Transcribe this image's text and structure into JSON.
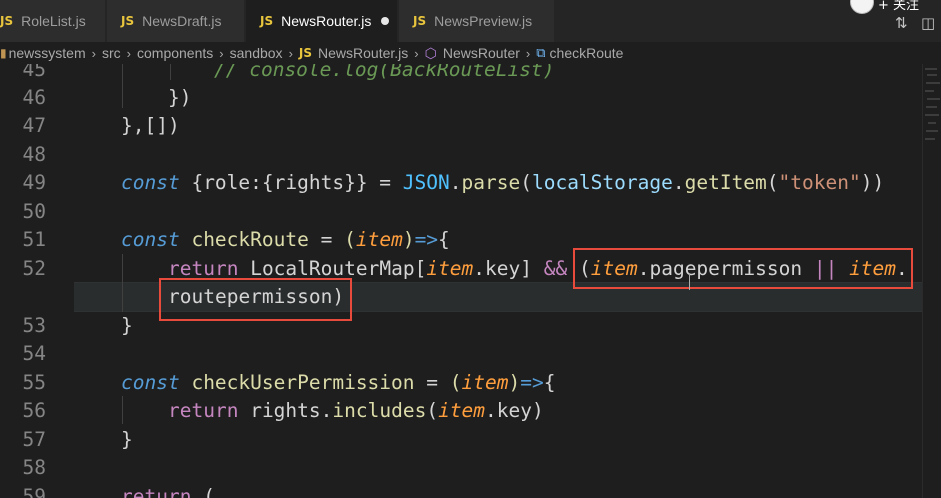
{
  "tabs": [
    {
      "badge": "JS",
      "label": "RoleList.js",
      "active": false,
      "modified": false
    },
    {
      "badge": "JS",
      "label": "NewsDraft.js",
      "active": false,
      "modified": false
    },
    {
      "badge": "JS",
      "label": "NewsRouter.js",
      "active": true,
      "modified": true
    },
    {
      "badge": "JS",
      "label": "NewsPreview.js",
      "active": false,
      "modified": false
    }
  ],
  "top_right": {
    "follow_label": "+ 关注"
  },
  "breadcrumb": {
    "items": [
      "newssystem",
      "src",
      "components",
      "sandbox",
      "NewsRouter.js",
      "NewsRouter",
      "checkRoute"
    ],
    "file_badge": "JS"
  },
  "editor": {
    "line_numbers": [
      "45",
      "46",
      "47",
      "48",
      "49",
      "50",
      "51",
      "52",
      "",
      "53",
      "54",
      "55",
      "56",
      "57",
      "58",
      "59"
    ],
    "comment_45": "// console.log(BackRouteList)",
    "l46_close": "})",
    "l47_close": "},[])",
    "l49": {
      "kw": "const",
      "destructure": "{role:{rights}}",
      "eq": " = ",
      "obj": "JSON",
      "dot": ".",
      "method": "parse",
      "open": "(",
      "arg_obj": "localStorage",
      "dot2": ".",
      "arg_method": "getItem",
      "open2": "(",
      "str": "\"token\"",
      "close": "))"
    },
    "l51": {
      "kw": "const",
      "name": "checkRoute",
      "eq": " = ",
      "open": "(",
      "param": "item",
      "close": ")",
      "arrow": "=>",
      "brace": "{"
    },
    "l52": {
      "ret": "return",
      "map": "LocalRouterMap",
      "lb": "[",
      "item": "item",
      "dot": ".",
      "key": "key",
      "rb": "]",
      "and": " && ",
      "lp": "(",
      "item2": "item",
      "dot2": ".",
      "prop": "pagepermisson",
      "or": " || ",
      "item3": "item",
      "dot3": "."
    },
    "l52b": {
      "prop": "routepermisson",
      "rp": ")"
    },
    "l53_close": "}",
    "l55": {
      "kw": "const",
      "name": "checkUserPermission",
      "eq": " = ",
      "open": "(",
      "param": "item",
      "close": ")",
      "arrow": "=>",
      "brace": "{"
    },
    "l56": {
      "ret": "return",
      "obj": "rights",
      "dot": ".",
      "method": "includes",
      "open": "(",
      "param": "item",
      "dot2": ".",
      "key": "key",
      "close": ")"
    },
    "l57_close": "}",
    "l59": {
      "ret": "return",
      "open": " ("
    }
  },
  "colors": {
    "highlight_box": "#e84b3c",
    "editor_bg": "#1e1e1e"
  }
}
